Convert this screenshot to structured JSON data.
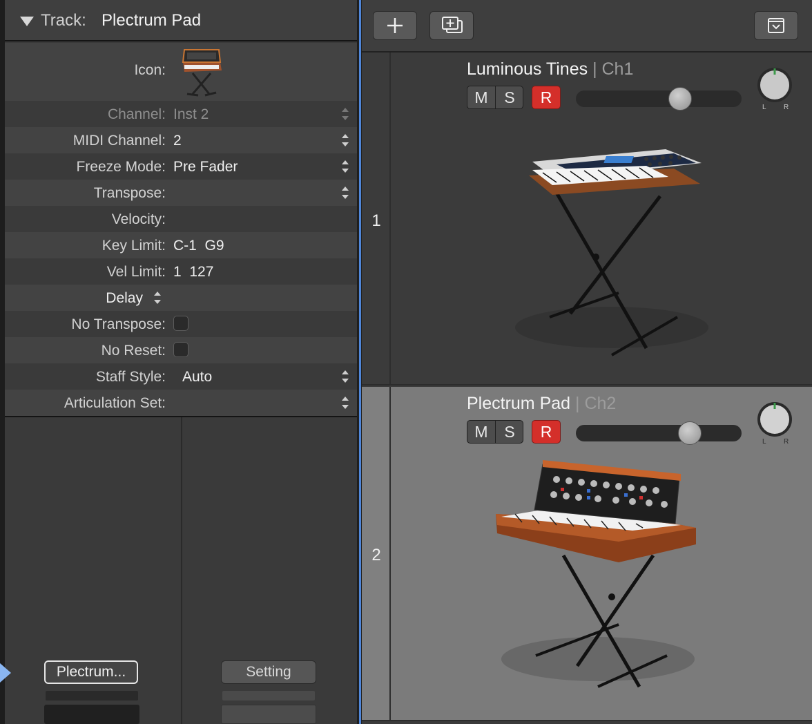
{
  "inspector": {
    "track_label": "Track:",
    "track_name": "Plectrum Pad",
    "icon_label": "Icon:",
    "rows": {
      "channel": {
        "label": "Channel:",
        "value": "Inst 2"
      },
      "midi_channel": {
        "label": "MIDI Channel:",
        "value": "2"
      },
      "freeze_mode": {
        "label": "Freeze Mode:",
        "value": "Pre Fader"
      },
      "transpose": {
        "label": "Transpose:",
        "value": ""
      },
      "velocity": {
        "label": "Velocity:",
        "value": ""
      },
      "key_limit": {
        "label": "Key Limit:",
        "value": "C-1  G9"
      },
      "vel_limit": {
        "label": "Vel Limit:",
        "value": "1  127"
      },
      "delay": {
        "label": "Delay"
      },
      "no_transpose": {
        "label": "No Transpose:",
        "checked": false
      },
      "no_reset": {
        "label": "No Reset:",
        "checked": false
      },
      "staff_style": {
        "label": "Staff Style:",
        "value": "Auto"
      },
      "articulation_set": {
        "label": "Articulation Set:",
        "value": ""
      }
    },
    "channel_strip": {
      "name_button": "Plectrum...",
      "setting_button": "Setting"
    }
  },
  "tracks": [
    {
      "number": "1",
      "name": "Luminous Tines",
      "channel": "| Ch1",
      "mute": "M",
      "solo": "S",
      "record": "R",
      "volume_fraction": 0.65,
      "pan_label_l": "L",
      "pan_label_r": "R",
      "icon": "electric-piano-icon"
    },
    {
      "number": "2",
      "name": "Plectrum Pad",
      "channel": "| Ch2",
      "mute": "M",
      "solo": "S",
      "record": "R",
      "volume_fraction": 0.72,
      "pan_label_l": "L",
      "pan_label_r": "R",
      "icon": "analog-synth-icon"
    }
  ],
  "toolbar": {
    "add_track": "plus-icon",
    "add_folder": "duplicate-track-icon",
    "collapse": "chevron-down-box-icon"
  },
  "colors": {
    "record_red": "#d42f2a",
    "selection_blue": "#4f86d9"
  }
}
